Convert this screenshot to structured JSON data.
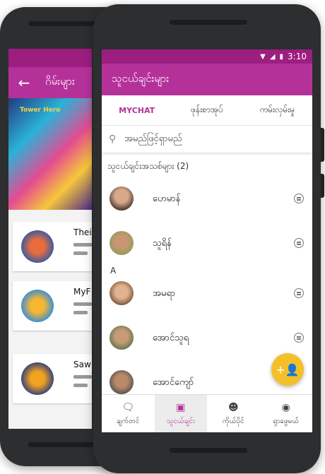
{
  "back_screen": {
    "title": "ဂိမ်းများ",
    "banner_logo": "Tower Hero",
    "games": [
      {
        "name": "Thei"
      },
      {
        "name": "MyF"
      },
      {
        "name": "Saw"
      }
    ]
  },
  "status_bar": {
    "time": "3:10"
  },
  "app_bar": {
    "title": "သူငယ်ချင်းများ"
  },
  "tabs": [
    {
      "label": "MYCHAT",
      "active": true
    },
    {
      "label": "ဖုန်းစာအုပ်",
      "active": false
    },
    {
      "label": "ကမ်းလှမ်းမှု",
      "active": false
    }
  ],
  "search": {
    "placeholder": "အမည်ဖြင့်ရှာမည်"
  },
  "section_header": "သူငယ်ချင်းအသစ်များ (2)",
  "letter_header": "A",
  "contacts": [
    {
      "name": "ဟေမာန်"
    },
    {
      "name": "သူရိန်"
    },
    {
      "name": "အမရာ"
    },
    {
      "name": "အောင်သူရ"
    },
    {
      "name": "အောင်ကျော်"
    }
  ],
  "bottom_nav": [
    {
      "label": "ချက်တင်",
      "icon": "chat-bubble-icon"
    },
    {
      "label": "သူငယ်ချင်း",
      "icon": "contacts-icon"
    },
    {
      "label": "ကိုယ်ပိုင်",
      "icon": "person-icon"
    },
    {
      "label": "ရှာဖွေမယ်",
      "icon": "explore-icon"
    }
  ],
  "colors": {
    "accent": "#b5319a",
    "status": "#9c1e7f",
    "fab": "#f4c02a"
  }
}
